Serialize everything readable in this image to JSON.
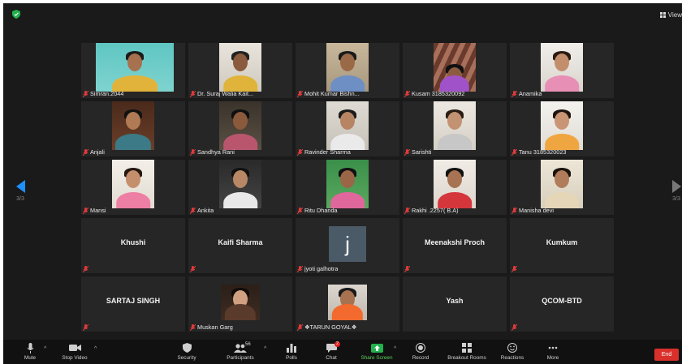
{
  "top": {
    "view_label": "View"
  },
  "pagination": {
    "left_page": "3/3",
    "right_page": "3/3"
  },
  "tiles": [
    {
      "name": "Simran.2044",
      "video": true
    },
    {
      "name": "Dr. Suraj Walia Kait...",
      "video": true
    },
    {
      "name": "Mohit Kumar Bishn...",
      "video": true
    },
    {
      "name": "Kusam 3185320092",
      "video": true
    },
    {
      "name": "Anamika",
      "video": true
    },
    {
      "name": "Anjali",
      "video": true
    },
    {
      "name": "Sandhya Rani",
      "video": true
    },
    {
      "name": "Ravinder Sharma",
      "video": true
    },
    {
      "name": "Sarishti",
      "video": true
    },
    {
      "name": "Tanu 3185320023",
      "video": true
    },
    {
      "name": "Mansi",
      "video": true
    },
    {
      "name": "Ankita",
      "video": true
    },
    {
      "name": "Ritu Dhanda",
      "video": true
    },
    {
      "name": "Rakhi .2257( B.A)",
      "video": true
    },
    {
      "name": "Manisha devi",
      "video": true
    },
    {
      "name": "",
      "title": "Khushi",
      "video": false
    },
    {
      "name": "",
      "title": "Kaifi Sharma",
      "video": false
    },
    {
      "name": "jyoti galhotra",
      "letter": "j",
      "video": false
    },
    {
      "name": "",
      "title": "Meenakshi Proch",
      "video": false
    },
    {
      "name": "",
      "title": "Kumkum",
      "video": false
    },
    {
      "name": "",
      "title": "SARTAJ SINGH",
      "video": false
    },
    {
      "name": "Muskan Garg",
      "video": true
    },
    {
      "name": "❖TARUN GOYAL❖",
      "video": true
    },
    {
      "name": "",
      "title": "Yash",
      "video": false
    },
    {
      "name": "",
      "title": "QCOM-BTD",
      "video": false
    }
  ],
  "toolbar": {
    "mute": "Mute",
    "stop_video": "Stop Video",
    "security": "Security",
    "participants": "Participants",
    "participants_count": "56",
    "polls": "Polls",
    "chat": "Chat",
    "chat_badge": "2",
    "share_screen": "Share Screen",
    "record": "Record",
    "breakout_rooms": "Breakout Rooms",
    "reactions": "Reactions",
    "more": "More",
    "end": "End"
  },
  "colors": {
    "accent_blue": "#1e90ff",
    "share_green": "#23b14d",
    "end_red": "#d9302c",
    "mic_muted_red": "#e03b3b"
  }
}
